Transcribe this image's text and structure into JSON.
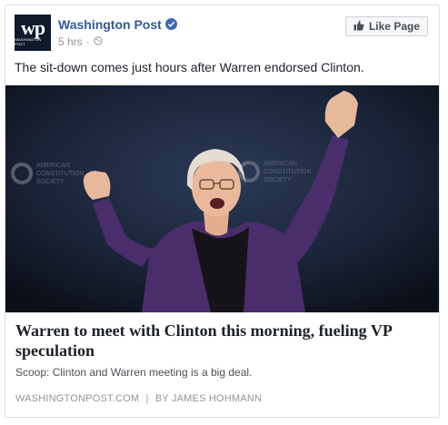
{
  "page": {
    "name": "Washington Post",
    "avatar_mark": "wp",
    "avatar_sub": "WASHINGTON POST",
    "time": "5 hrs",
    "separator": "·",
    "verified_icon": "verified-badge-icon",
    "privacy_icon": "globe-icon",
    "accent_color": "#365899"
  },
  "actions": {
    "like_page_label": "Like Page",
    "like_icon": "thumbs-up-icon"
  },
  "post": {
    "text": "The sit-down comes just hours after Warren endorsed Clinton."
  },
  "photo": {
    "backdrop_text": [
      "AMERICAN",
      "CONSTITUTION",
      "SOCIETY"
    ]
  },
  "link": {
    "headline": "Warren to meet with Clinton this morning, fueling VP speculation",
    "description": "Scoop: Clinton and Warren meeting is a big deal.",
    "domain": "WASHINGTONPOST.COM",
    "divider": "|",
    "byline": "BY JAMES HOHMANN"
  }
}
